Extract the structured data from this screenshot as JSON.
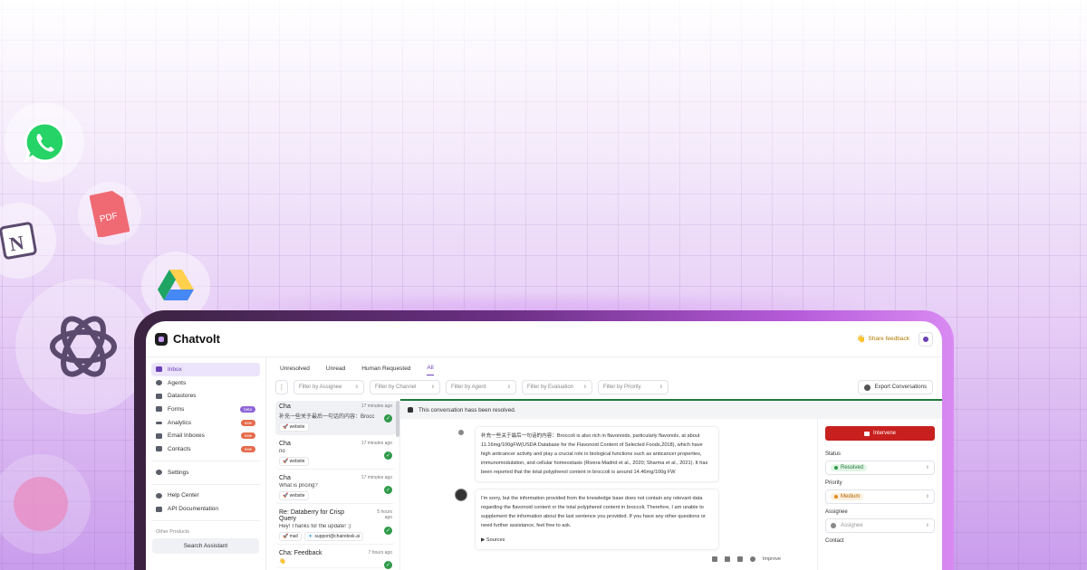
{
  "app": {
    "name": "Chatvolt"
  },
  "header": {
    "share_feedback": "Share feedback",
    "hand_emoji": "👋"
  },
  "decor": {
    "pdf_label": "PDF",
    "notion_label": "N",
    "colors": {
      "whatsapp": "#25d366",
      "pdf": "#f06a73",
      "openai": "#5b4a6e",
      "drive_green": "#1fa463",
      "drive_yellow": "#ffd04b",
      "drive_blue": "#4688f4"
    }
  },
  "sidebar": {
    "items": [
      {
        "label": "Inbox",
        "active": true
      },
      {
        "label": "Agents"
      },
      {
        "label": "Datastores"
      },
      {
        "label": "Forms",
        "badge": "beta"
      },
      {
        "label": "Analytics",
        "badge": "new"
      },
      {
        "label": "Email Inboxes",
        "badge": "new"
      },
      {
        "label": "Contacts",
        "badge": "new"
      }
    ],
    "settings": "Settings",
    "help_center": "Help Center",
    "api_docs": "API Documentation",
    "other_products": "Other Products",
    "search_assistant": "Search Assistant"
  },
  "tabs": [
    "Unresolved",
    "Unread",
    "Human Requested",
    "All"
  ],
  "active_tab": "All",
  "filters": {
    "kebab": "⋮",
    "assignee": "Filter by Assignee",
    "channel": "Filter by Channel",
    "agent": "Filter by Agent",
    "evaluation": "Filter by Evaluation",
    "priority": "Filter by Priority",
    "export": "Export Conversations"
  },
  "conversations": [
    {
      "title": "Cha",
      "time": "17 minutes ago",
      "message": "补充一些关于最后一句话的内容：Brocc",
      "tags": [
        "🚀 website"
      ]
    },
    {
      "title": "Cha",
      "time": "17 minutes ago",
      "message": "no",
      "tags": [
        "🚀 website"
      ]
    },
    {
      "title": "Cha",
      "time": "17 minutes ago",
      "message": "What is pricing?",
      "tags": [
        "🚀 website"
      ]
    },
    {
      "title": "Re: Databerry for Crisp Query",
      "time": "5 hours ago",
      "message": "Hey! Thanks for the update! :)",
      "tags": [
        "🚀 mail",
        "📧 support@chaindesk.ai"
      ]
    },
    {
      "title": "Cha: Feedback",
      "time": "7 hours ago",
      "message": "👋",
      "tags": []
    }
  ],
  "chat": {
    "resolved_notice": "This conversation hass been resolved.",
    "user_message": "补充一些关于最后一句话的内容：Broccoli is also rich in flavonoids, particularly flavonols, at about 11.16mg/100gFW(USDA Database for the Flavonoid Content of Selected Foods,2018), which have high anticancer activity and play a crucial role in biological functions such as anticancer properties, immunomodulation, and cellular homeostasis (Rivera-Madrid et al., 2020; Sharma et al., 2021). It has been reported that the total polyphenol content in broccoli is around 14.46mg/100g FW",
    "bot_message": "I'm sorry, but the information provided from the knowledge base does not contain any relevant data regarding the flavonoid content or the total polyphenol content in broccoli. Therefore, I am unable to supplement the information about the last sentence you provided. If you have any other questions or need further assistance, feel free to ask.",
    "sources_label": "▶ Sources",
    "improve_label": "Improve"
  },
  "details": {
    "intervene": "Intervene",
    "status_label": "Status",
    "status_value": "Resolved",
    "priority_label": "Priority",
    "priority_value": "Medium",
    "assignee_label": "Assignee",
    "assignee_placeholder": "Assignee",
    "contact_label": "Contact"
  }
}
